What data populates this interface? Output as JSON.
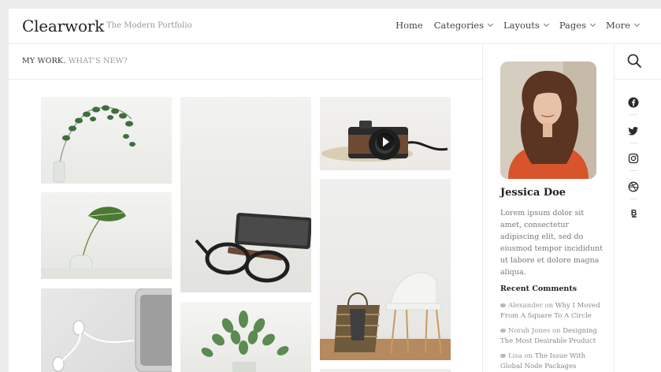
{
  "site": {
    "logo": "Clearwork",
    "tagline": "The Modern Portfolio"
  },
  "nav": {
    "items": [
      {
        "label": "Home",
        "has_dropdown": false
      },
      {
        "label": "Categories",
        "has_dropdown": true
      },
      {
        "label": "Layouts",
        "has_dropdown": true
      },
      {
        "label": "Pages",
        "has_dropdown": true
      },
      {
        "label": "More",
        "has_dropdown": true
      }
    ]
  },
  "subheader": {
    "primary": "MY WORK.",
    "secondary": "WHAT'S NEW?"
  },
  "gallery": {
    "items": [
      {
        "subject": "eucalyptus branch in glass vase",
        "icon": "plant-image"
      },
      {
        "subject": "monstera leaf in glass",
        "icon": "plant-image"
      },
      {
        "subject": "earphones and phone",
        "icon": "earphones-image"
      },
      {
        "subject": "glasses and e-reader",
        "icon": "glasses-image"
      },
      {
        "subject": "green plant bouquet",
        "icon": "plant-image"
      },
      {
        "subject": "vintage camera",
        "icon": "camera-image",
        "has_video": true
      },
      {
        "subject": "basket and white chair",
        "icon": "chair-image"
      }
    ]
  },
  "sidebar": {
    "profile": {
      "name": "Jessica Doe",
      "bio": "Lorem ipsum dolor sit amet, consectetur adipiscing elit, sed do eiusmod tempor incididunt ut labore et dolore magna aliqua."
    },
    "recent_comments": {
      "title": "Recent Comments",
      "items": [
        {
          "author": "Alexander",
          "on": "on",
          "post": "Why I Moved From A Square To A Circle"
        },
        {
          "author": "Norah Jones",
          "on": "on",
          "post": "Designing The Most Desirable Product"
        },
        {
          "author": "Lisa",
          "on": "on",
          "post": "The Issue With Global Node Packages"
        }
      ]
    }
  },
  "rail": {
    "icons": [
      "search-icon",
      "facebook-icon",
      "twitter-icon",
      "instagram-icon",
      "dribbble-icon",
      "behance-icon"
    ]
  },
  "colors": {
    "background": "#ececec",
    "panel": "#ffffff",
    "text": "#333333",
    "muted": "#999999",
    "accent_orange": "#d8542c"
  }
}
